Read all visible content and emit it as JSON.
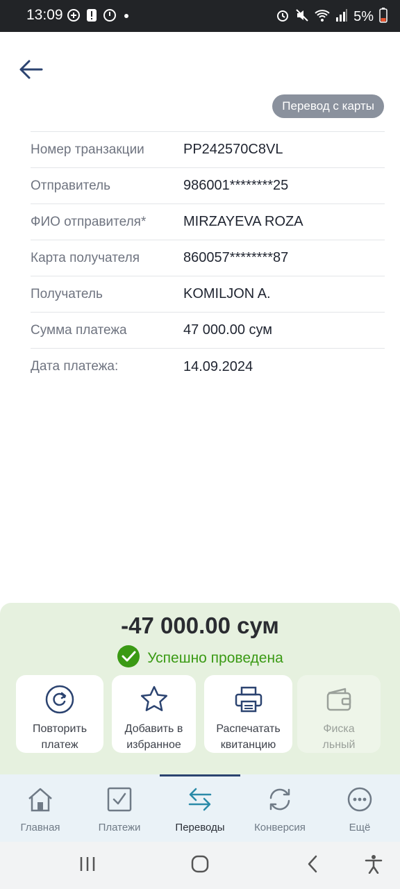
{
  "status_bar": {
    "time": "13:09",
    "battery": "5%",
    "icons_left": [
      "add-circle-icon",
      "alert-icon",
      "power-icon",
      "dot-icon"
    ],
    "icons_right": [
      "alarm-icon",
      "mute-icon",
      "wifi-icon",
      "signal-icon",
      "battery-icon"
    ]
  },
  "header": {
    "back_icon": "arrow-left-icon",
    "type_badge": "Перевод с карты"
  },
  "details": [
    {
      "label": "Номер транзакции",
      "value": "PP242570C8VL"
    },
    {
      "label": "Отправитель",
      "value": "986001********25"
    },
    {
      "label": "ФИО отправителя*",
      "value": "MIRZAYEVA ROZA"
    },
    {
      "label": "Карта получателя",
      "value": "860057********87"
    },
    {
      "label": "Получатель",
      "value": "KOMILJON A."
    },
    {
      "label": "Сумма платежа",
      "value": "47 000.00 сум"
    },
    {
      "label": "Дата платежа:",
      "value": "14.09.2024"
    }
  ],
  "result": {
    "amount": "-47 000.00 сум",
    "status": "Успешно проведена",
    "status_color": "#3a9a14",
    "actions": [
      {
        "label": "Повторить\nплатеж",
        "icon": "repeat-icon"
      },
      {
        "label": "Добавить в\nизбранное",
        "icon": "star-icon"
      },
      {
        "label": "Распечатать\nквитанцию",
        "icon": "printer-icon"
      },
      {
        "label": "Фиска\nльный",
        "icon": "wallet-icon"
      }
    ]
  },
  "bottom_nav": {
    "items": [
      {
        "label": "Главная",
        "icon": "home-icon"
      },
      {
        "label": "Платежи",
        "icon": "checkbox-icon"
      },
      {
        "label": "Переводы",
        "icon": "transfer-icon"
      },
      {
        "label": "Конверсия",
        "icon": "exchange-icon"
      },
      {
        "label": "Ещё",
        "icon": "more-icon"
      }
    ],
    "active": "Переводы"
  },
  "system_nav": [
    "recents-icon",
    "home-circle-icon",
    "back-chevron-icon",
    "accessibility-icon"
  ]
}
